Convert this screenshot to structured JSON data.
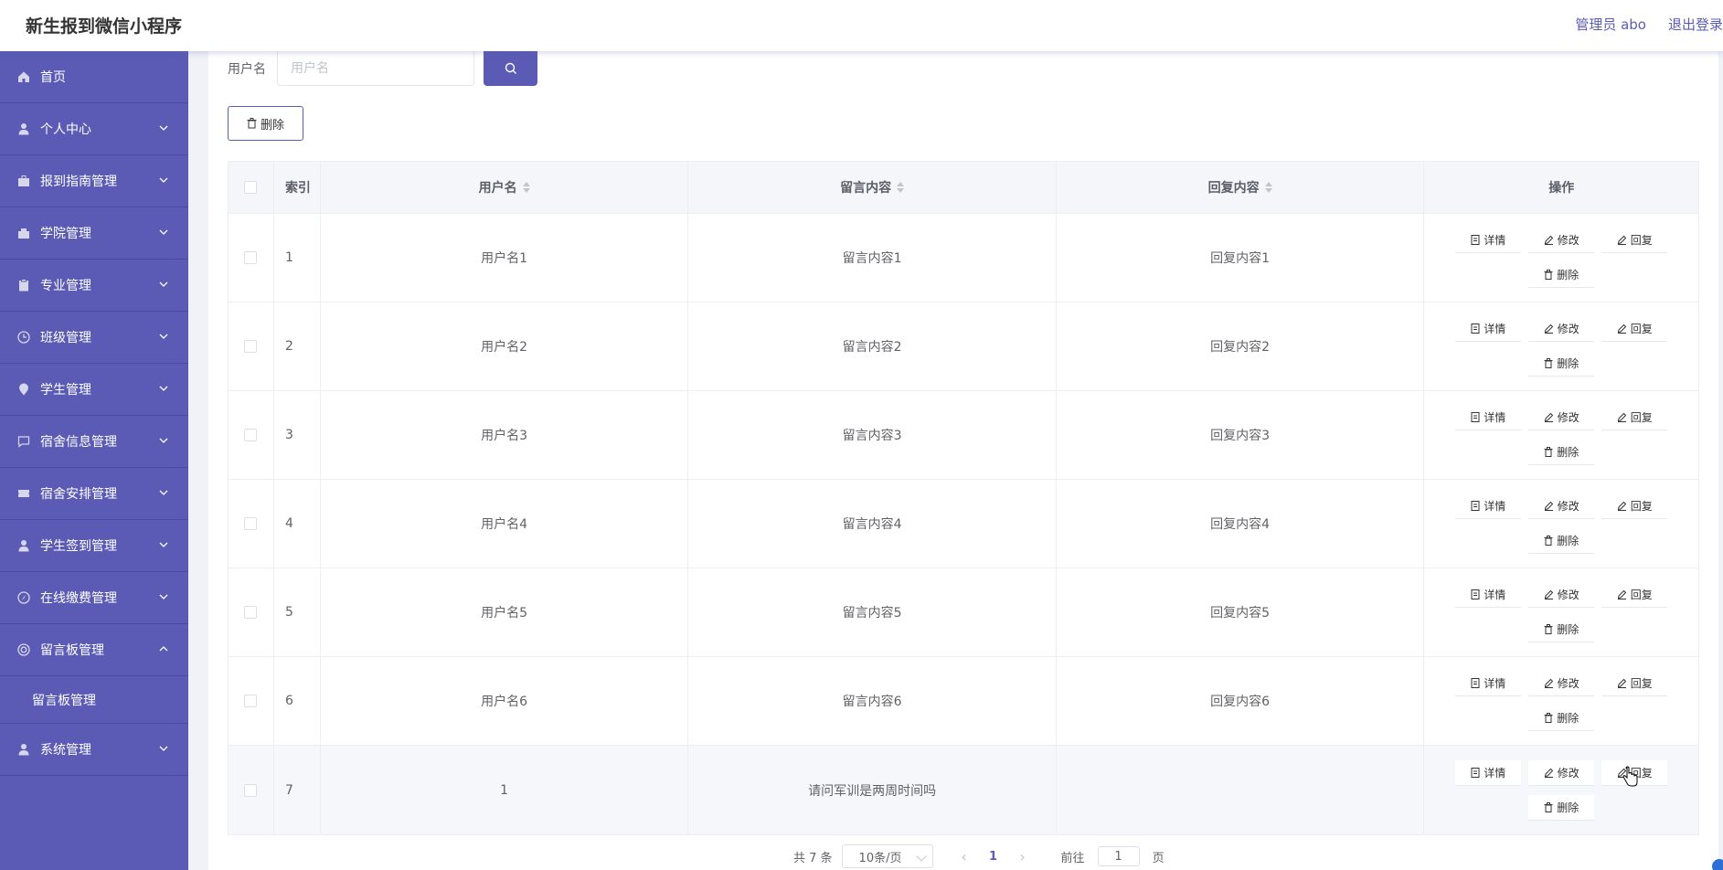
{
  "header": {
    "title": "新生报到微信小程序",
    "admin_label": "管理员 abo",
    "logout_label": "退出登录"
  },
  "sidebar": {
    "items": [
      {
        "label": "首页",
        "icon": "home-icon"
      },
      {
        "label": "个人中心",
        "icon": "user-icon"
      },
      {
        "label": "报到指南管理",
        "icon": "briefcase-icon"
      },
      {
        "label": "学院管理",
        "icon": "building-icon"
      },
      {
        "label": "专业管理",
        "icon": "clipboard-icon"
      },
      {
        "label": "班级管理",
        "icon": "clock-icon"
      },
      {
        "label": "学生管理",
        "icon": "location-icon"
      },
      {
        "label": "宿舍信息管理",
        "icon": "chat-icon"
      },
      {
        "label": "宿舍安排管理",
        "icon": "ticket-icon"
      },
      {
        "label": "学生签到管理",
        "icon": "user-icon"
      },
      {
        "label": "在线缴费管理",
        "icon": "compass-icon"
      },
      {
        "label": "留言板管理",
        "icon": "lifebuoy-icon"
      },
      {
        "label": "系统管理",
        "icon": "user-icon"
      }
    ],
    "submenu_label": "留言板管理"
  },
  "search": {
    "label": "用户名",
    "placeholder": "用户名"
  },
  "toolbar": {
    "delete_label": "删除"
  },
  "table": {
    "headers": {
      "index": "索引",
      "username": "用户名",
      "message": "留言内容",
      "reply": "回复内容",
      "ops": "操作"
    },
    "rows": [
      {
        "index": "1",
        "username": "用户名1",
        "message": "留言内容1",
        "reply": "回复内容1"
      },
      {
        "index": "2",
        "username": "用户名2",
        "message": "留言内容2",
        "reply": "回复内容2"
      },
      {
        "index": "3",
        "username": "用户名3",
        "message": "留言内容3",
        "reply": "回复内容3"
      },
      {
        "index": "4",
        "username": "用户名4",
        "message": "留言内容4",
        "reply": "回复内容4"
      },
      {
        "index": "5",
        "username": "用户名5",
        "message": "留言内容5",
        "reply": "回复内容5"
      },
      {
        "index": "6",
        "username": "用户名6",
        "message": "留言内容6",
        "reply": "回复内容6"
      },
      {
        "index": "7",
        "username": "1",
        "message": "请问军训是两周时间吗",
        "reply": ""
      }
    ],
    "op_labels": {
      "detail": "详情",
      "edit": "修改",
      "reply": "回复",
      "delete": "删除"
    }
  },
  "pagination": {
    "total": "共 7 条",
    "page_size": "10条/页",
    "current_page": "1",
    "goto_prefix": "前往",
    "goto_value": "1",
    "goto_suffix": "页"
  },
  "colors": {
    "primary": "#5b5bb5",
    "sidebar_bg": "#5b5bb5"
  }
}
